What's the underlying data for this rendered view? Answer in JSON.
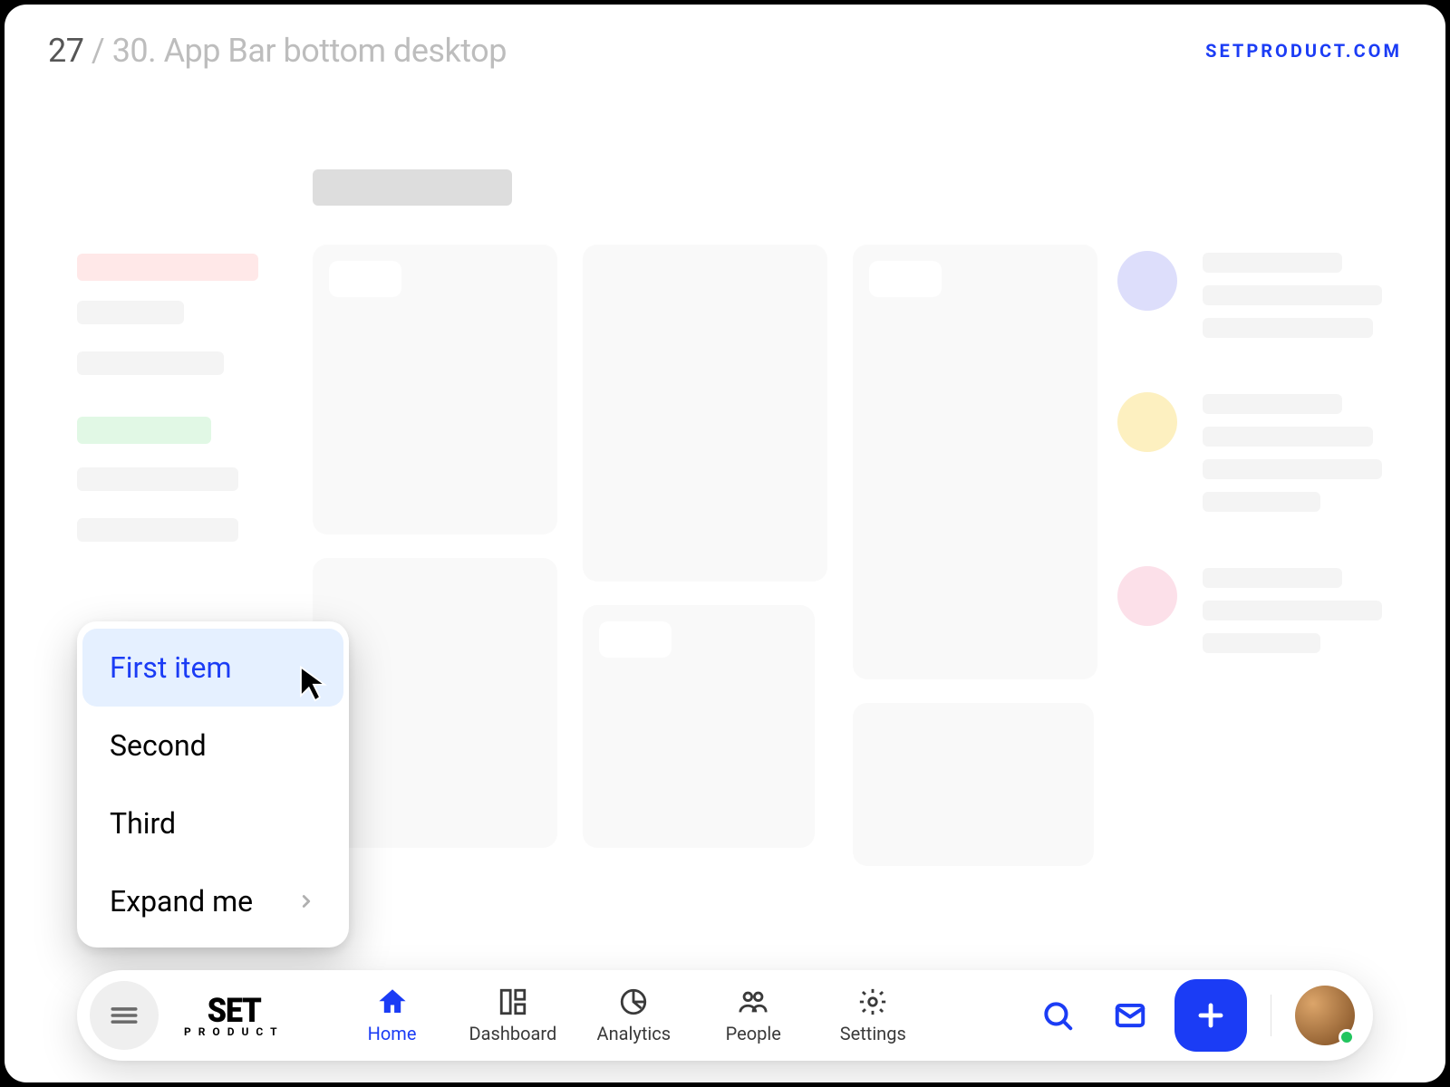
{
  "header": {
    "counter_current": "27",
    "counter_total": "/ 30. App Bar bottom desktop",
    "brand": "SETPRODUCT.COM"
  },
  "menu": {
    "items": [
      {
        "label": "First item",
        "active": true
      },
      {
        "label": "Second",
        "active": false
      },
      {
        "label": "Third",
        "active": false
      },
      {
        "label": "Expand me",
        "active": false,
        "expandable": true
      }
    ]
  },
  "appbar": {
    "logo_top": "SET",
    "logo_bottom": "PRODUCT",
    "nav": [
      {
        "id": "home",
        "label": "Home",
        "icon": "home-icon",
        "active": true
      },
      {
        "id": "dashboard",
        "label": "Dashboard",
        "icon": "dashboard-icon",
        "active": false
      },
      {
        "id": "analytics",
        "label": "Analytics",
        "icon": "analytics-icon",
        "active": false
      },
      {
        "id": "people",
        "label": "People",
        "icon": "people-icon",
        "active": false
      },
      {
        "id": "settings",
        "label": "Settings",
        "icon": "gear-icon",
        "active": false
      }
    ],
    "actions": {
      "search": "search-icon",
      "mail": "mail-icon",
      "add": "plus-icon"
    },
    "avatar_status": "online"
  },
  "colors": {
    "accent": "#1b3cf5",
    "hover": "#e5f0ff",
    "chip_red": "#ffd6d6",
    "chip_green": "#c8f3cf",
    "dot_blue": "#c1c3f8",
    "dot_yellow": "#fbe48d",
    "dot_pink": "#f9c6d8",
    "status_green": "#22c55e"
  }
}
